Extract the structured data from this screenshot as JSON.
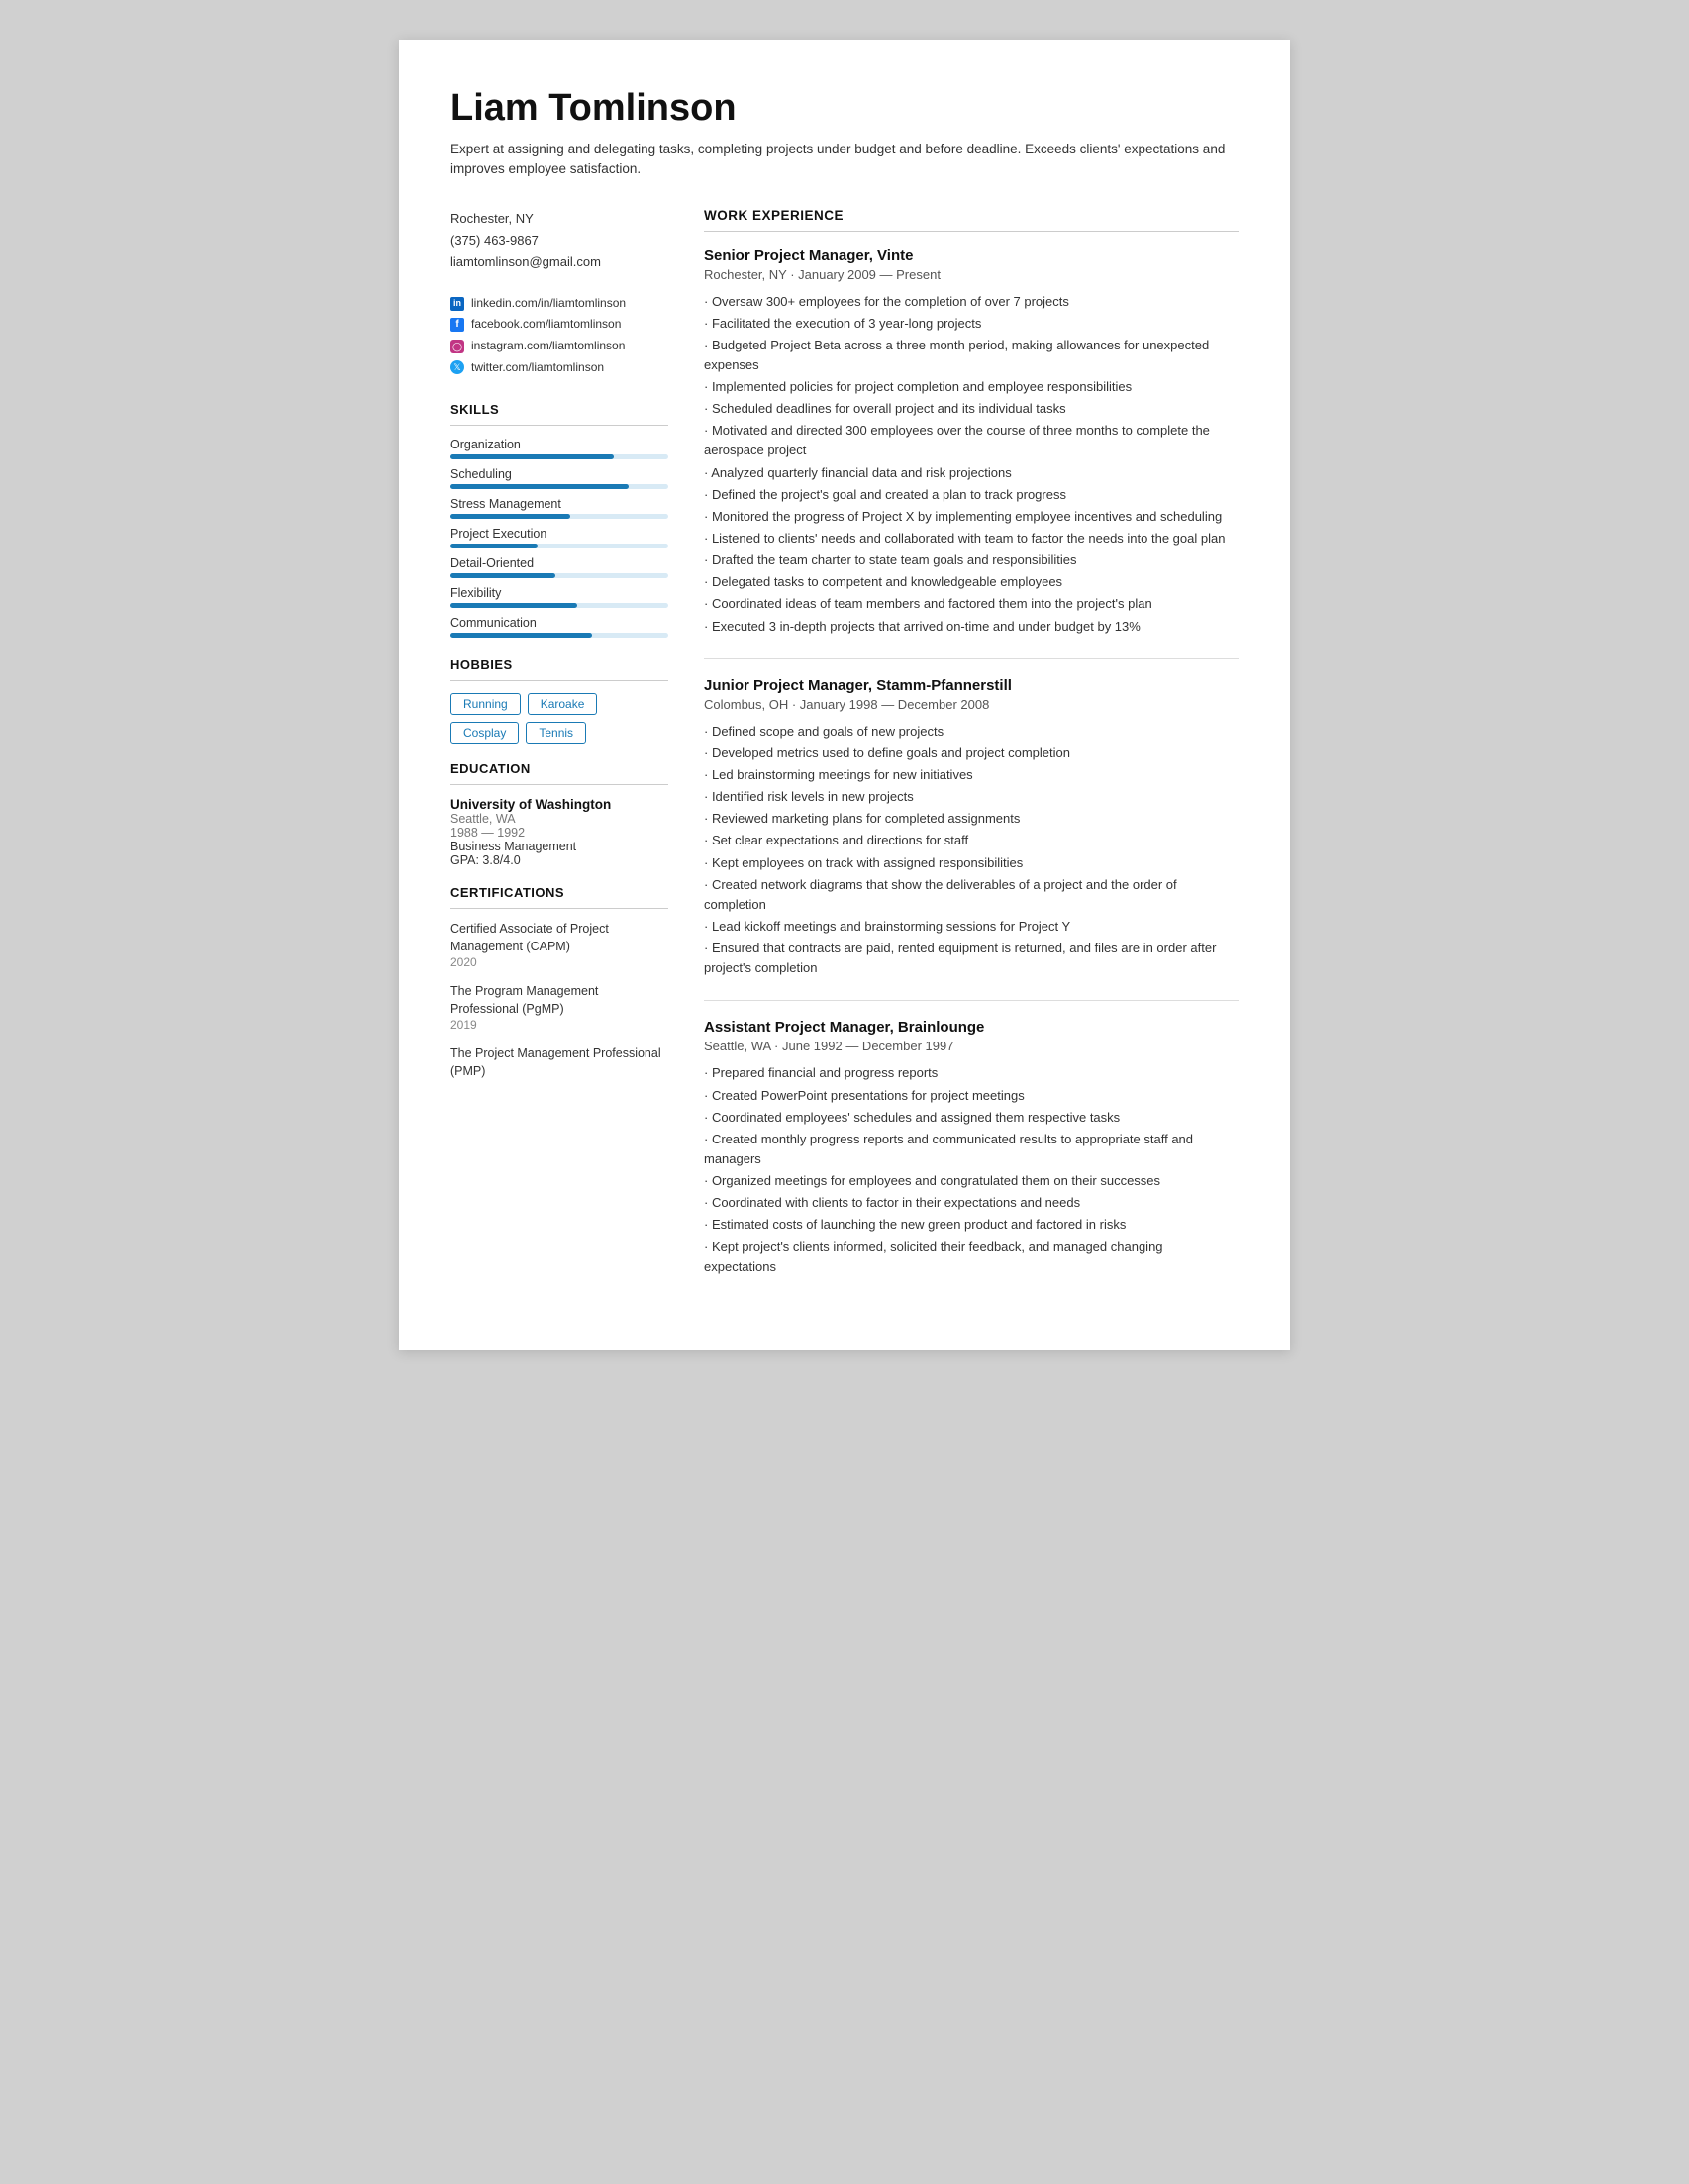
{
  "header": {
    "name": "Liam Tomlinson",
    "summary": "Expert at assigning and delegating tasks, completing projects under budget and before deadline. Exceeds clients' expectations and improves employee satisfaction."
  },
  "contact": {
    "location": "Rochester, NY",
    "phone": "(375) 463-9867",
    "email": "liamtomlinson@gmail.com"
  },
  "social": [
    {
      "icon": "linkedin",
      "text": "linkedin.com/in/liamtomlinson"
    },
    {
      "icon": "facebook",
      "text": "facebook.com/liamtomlinson"
    },
    {
      "icon": "instagram",
      "text": "instagram.com/liamtomlinson"
    },
    {
      "icon": "twitter",
      "text": "twitter.com/liamtomlinson"
    }
  ],
  "skills": {
    "label": "SKILLS",
    "items": [
      {
        "name": "Organization",
        "pct": 75
      },
      {
        "name": "Scheduling",
        "pct": 82
      },
      {
        "name": "Stress Management",
        "pct": 55
      },
      {
        "name": "Project Execution",
        "pct": 40
      },
      {
        "name": "Detail-Oriented",
        "pct": 48
      },
      {
        "name": "Flexibility",
        "pct": 58
      },
      {
        "name": "Communication",
        "pct": 65
      }
    ]
  },
  "hobbies": {
    "label": "HOBBIES",
    "items": [
      "Running",
      "Karoake",
      "Cosplay",
      "Tennis"
    ]
  },
  "education": {
    "label": "EDUCATION",
    "university": "University of Washington",
    "location": "Seattle, WA",
    "years": "1988 — 1992",
    "field": "Business Management",
    "gpa": "GPA: 3.8/4.0"
  },
  "certifications": {
    "label": "CERTIFICATIONS",
    "items": [
      {
        "name": "Certified Associate of Project Management (CAPM)",
        "year": "2020"
      },
      {
        "name": "The Program Management Professional (PgMP)",
        "year": "2019"
      },
      {
        "name": "The Project Management Professional (PMP)",
        "year": ""
      }
    ]
  },
  "work": {
    "label": "WORK EXPERIENCE",
    "jobs": [
      {
        "title": "Senior Project Manager, Vinte",
        "meta": "Rochester, NY · January 2009 — Present",
        "bullets": [
          "Oversaw 300+ employees for the completion of over 7 projects",
          "Facilitated the execution of 3 year-long projects",
          "Budgeted Project Beta across a three month period, making allowances for unexpected expenses",
          "Implemented policies for project completion and employee responsibilities",
          "Scheduled deadlines for overall project and its individual tasks",
          "Motivated and directed 300 employees over the course of three months to complete the aerospace project",
          "Analyzed quarterly financial data and risk projections",
          "Defined the project's goal and created a plan to track progress",
          "Monitored the progress of Project X by implementing employee incentives and scheduling",
          "Listened to clients' needs and collaborated with team to factor the needs into the goal plan",
          "Drafted the team charter to state team goals and responsibilities",
          "Delegated tasks to competent and knowledgeable employees",
          "Coordinated ideas of team members and factored them into the project's plan",
          "Executed 3 in-depth projects that arrived on-time and under budget by 13%"
        ]
      },
      {
        "title": "Junior Project Manager, Stamm-Pfannerstill",
        "meta": "Colombus, OH · January 1998 — December 2008",
        "bullets": [
          "Defined scope and goals of new projects",
          "Developed metrics used to define goals and project completion",
          "Led brainstorming meetings for new initiatives",
          "Identified risk levels in new projects",
          "Reviewed marketing plans for completed assignments",
          "Set clear expectations and directions for staff",
          "Kept employees on track with assigned responsibilities",
          "Created network diagrams that show the deliverables of a project and the order of completion",
          "Lead kickoff meetings and brainstorming sessions for Project Y",
          "Ensured that contracts are paid, rented equipment is returned, and files are in order after project's completion"
        ]
      },
      {
        "title": "Assistant Project Manager, Brainlounge",
        "meta": "Seattle, WA · June 1992 — December 1997",
        "bullets": [
          "Prepared financial and progress reports",
          "Created PowerPoint presentations for project meetings",
          "Coordinated employees' schedules and assigned them respective tasks",
          "Created monthly progress reports and communicated results to appropriate staff and managers",
          "Organized meetings for employees and congratulated them on their successes",
          "Coordinated with clients to factor in their expectations and needs",
          "Estimated costs of launching the new green product and factored in risks",
          "Kept project's clients informed, solicited their feedback, and managed changing expectations"
        ]
      }
    ]
  }
}
